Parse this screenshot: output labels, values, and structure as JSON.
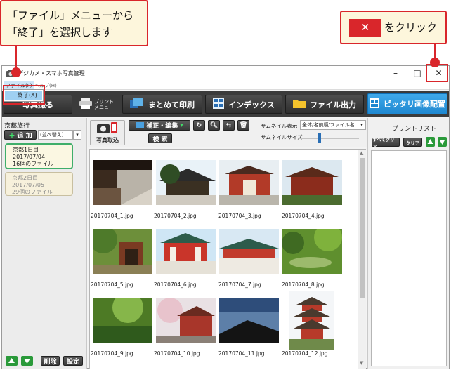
{
  "callouts": {
    "menu_instruction": "「ファイル」メニューから\n「終了」を選択します",
    "close_instruction": "をクリック",
    "close_icon": "close-x-icon"
  },
  "window": {
    "title": "デジカメ・スマホ写真管理",
    "minimize": "–",
    "maximize": "□",
    "close": "✕"
  },
  "menu": {
    "file": "ファイル(F)",
    "help": "ヘルプ(H)",
    "exit_item": "終了(X)"
  },
  "toolbar": {
    "left_partial": "写真撮る",
    "print_menu": "プリント\nメニュー",
    "batch_print": "まとめて印刷",
    "index": "インデックス",
    "file_output": "ファイル出力",
    "fit_layout": "ピッタリ画像配置"
  },
  "left_panel": {
    "album_title": "京都旅行",
    "add_button": "追 加",
    "sort_select": "(並べ替え)",
    "albums": [
      {
        "name": "京都1日目",
        "date": "2017/07/04",
        "count": "16個のファイル"
      },
      {
        "name": "京都2日目",
        "date": "2017/07/05",
        "count": "29個のファイル"
      }
    ],
    "delete_button": "削除",
    "settings_button": "設定"
  },
  "content_toolbar": {
    "import_label": "写真取込",
    "edit_button": "補正・編集",
    "search_button": "検 索",
    "thumb_display_label": "サムネイル表示",
    "thumb_display_value": "全体/名前順/ファイル名",
    "thumb_size_label": "サムネイルサイズ"
  },
  "photos": [
    {
      "name": "20170704_1.jpg"
    },
    {
      "name": "20170704_2.jpg"
    },
    {
      "name": "20170704_3.jpg"
    },
    {
      "name": "20170704_4.jpg"
    },
    {
      "name": "20170704_5.jpg"
    },
    {
      "name": "20170704_6.jpg"
    },
    {
      "name": "20170704_7.jpg"
    },
    {
      "name": "20170704_8.jpg"
    },
    {
      "name": "20170704_9.jpg"
    },
    {
      "name": "20170704_10.jpg"
    },
    {
      "name": "20170704_11.jpg"
    },
    {
      "name": "20170704_12.jpg"
    }
  ],
  "right_panel": {
    "title": "プリントリスト",
    "clear_all": "すべてクリア",
    "clear": "クリア"
  },
  "colors": {
    "accent_red": "#d9262b",
    "callout_bg": "#fdf6dc",
    "toolbar_dark": "#3b3b3b",
    "highlight_blue": "#1e87d0",
    "album_green": "#3fae6a"
  }
}
